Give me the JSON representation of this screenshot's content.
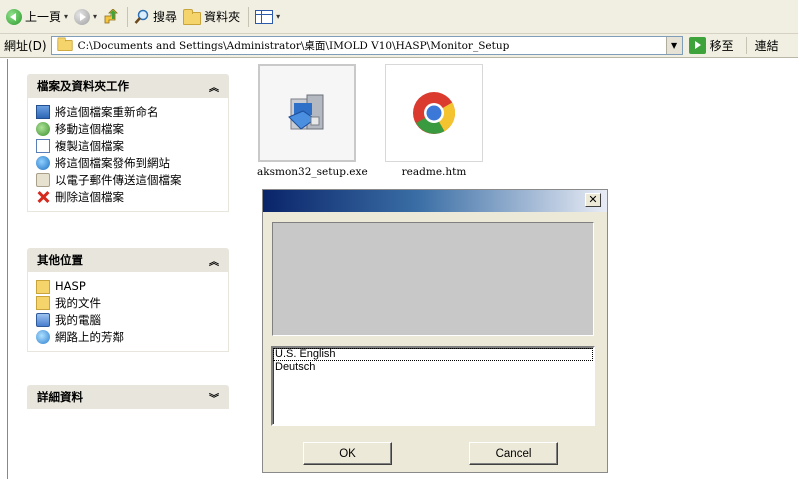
{
  "toolbar": {
    "back_label": "上一頁",
    "search_label": "搜尋",
    "folders_label": "資料夾"
  },
  "address_bar": {
    "label": "網址(D)",
    "path": "C:\\Documents and Settings\\Administrator\\桌面\\IMOLD V10\\HASP\\Monitor_Setup",
    "go_label": "移至",
    "links_label": "連結"
  },
  "tasks_panel": {
    "title": "檔案及資料夾工作",
    "items": [
      {
        "label": "將這個檔案重新命名",
        "icon": "rename-icon"
      },
      {
        "label": "移動這個檔案",
        "icon": "move-icon"
      },
      {
        "label": "複製這個檔案",
        "icon": "copy-icon"
      },
      {
        "label": "將這個檔案發佈到網站",
        "icon": "publish-icon"
      },
      {
        "label": "以電子郵件傳送這個檔案",
        "icon": "email-icon"
      },
      {
        "label": "刪除這個檔案",
        "icon": "delete-icon"
      }
    ]
  },
  "places_panel": {
    "title": "其他位置",
    "items": [
      {
        "label": "HASP",
        "icon": "folder-icon"
      },
      {
        "label": "我的文件",
        "icon": "my-documents-icon"
      },
      {
        "label": "我的電腦",
        "icon": "my-computer-icon"
      },
      {
        "label": "網路上的芳鄰",
        "icon": "network-icon"
      }
    ]
  },
  "details_panel": {
    "title": "詳細資料"
  },
  "files": [
    {
      "name": "aksmon32_setup.exe",
      "icon": "installer-icon",
      "selected": true
    },
    {
      "name": "readme.htm",
      "icon": "chrome-icon",
      "selected": false
    }
  ],
  "dialog": {
    "title": "",
    "languages": [
      "U.S. English",
      "Deutsch"
    ],
    "ok_label": "OK",
    "cancel_label": "Cancel"
  },
  "colors": {
    "toolbar_bg": "#f1efe2",
    "panel_header_bg": "#e8e6dc",
    "dialog_bg": "#ece9d8",
    "titlebar_start": "#0a246a"
  }
}
